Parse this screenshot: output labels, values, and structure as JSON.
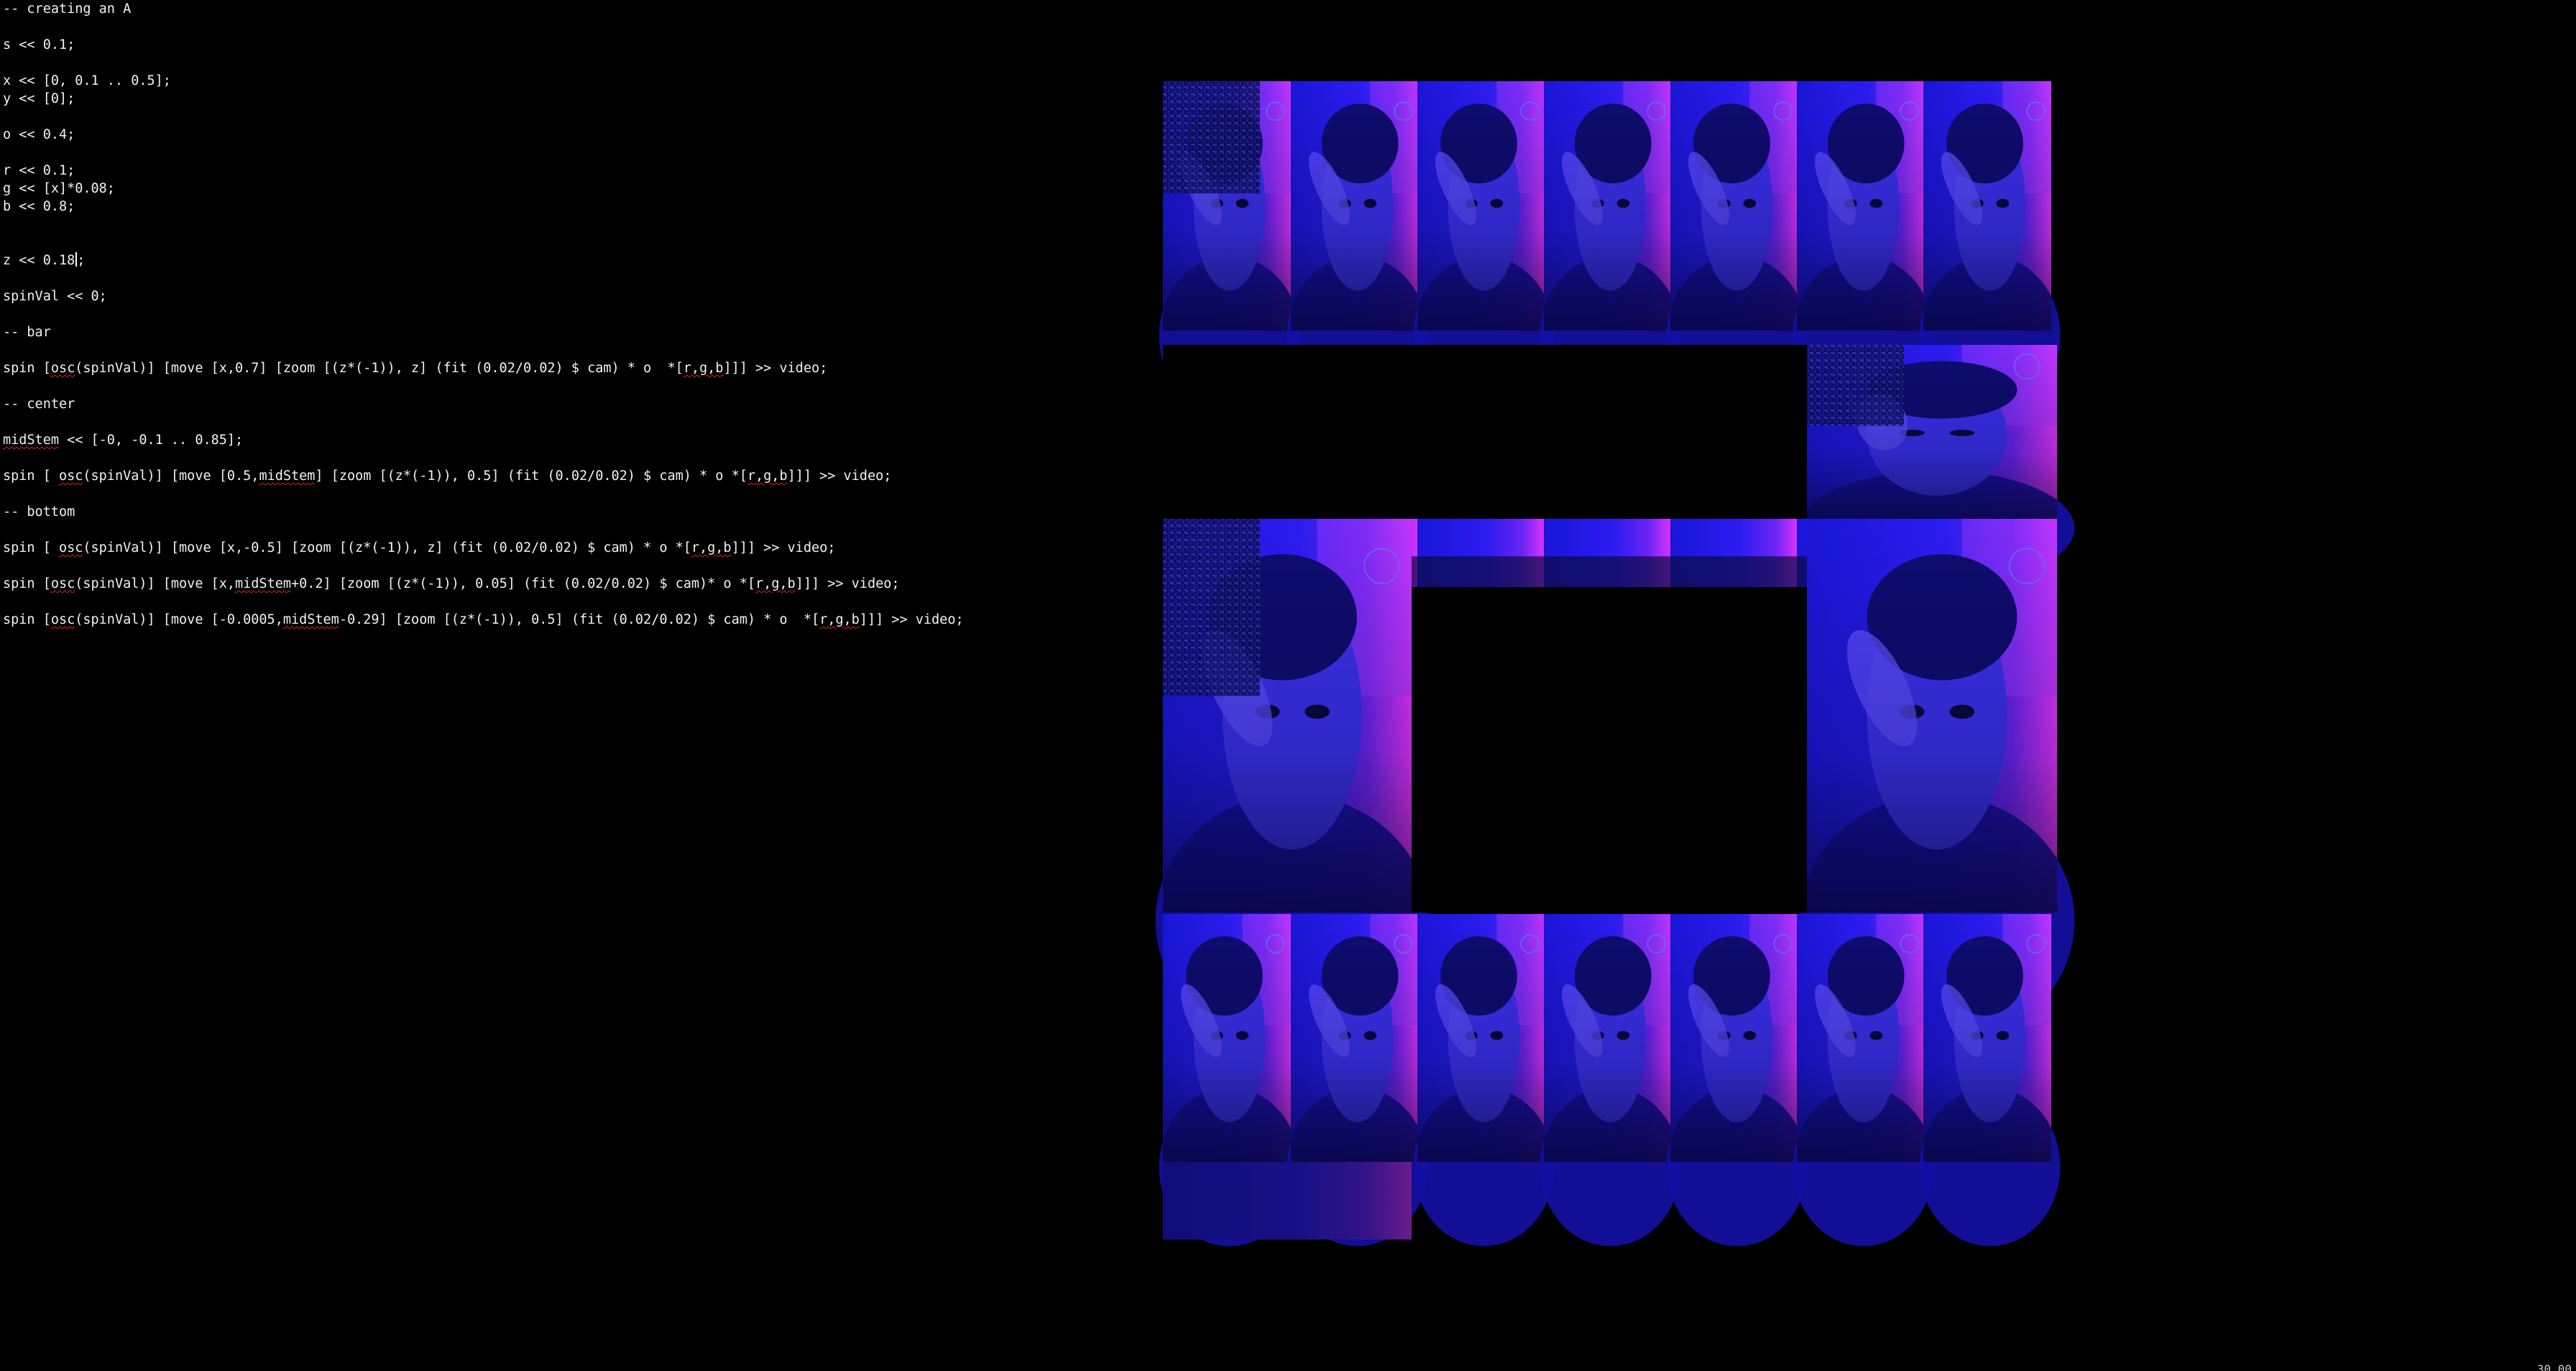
{
  "editor": {
    "lines": [
      "-- creating an A",
      "",
      "s << 0.1;",
      "",
      "x << [0, 0.1 .. 0.5];",
      "y << [0];",
      "",
      "o << 0.4;",
      "",
      "r << 0.1;",
      "g << [x]*0.08;",
      "b << 0.8;",
      "",
      "",
      "z << 0.18;",
      "",
      "spinVal << 0;",
      "",
      "-- bar",
      "",
      "spin [osc(spinVal)] [move [x,0.7] [zoom [(z*(-1)), z] (fit (0.02/0.02) $ cam) * o  *[r,g,b]]] >> video;",
      "",
      "-- center",
      "",
      "midStem << [-0, -0.1 .. 0.85];",
      "",
      "spin [ osc(spinVal)] [move [0.5,midStem] [zoom [(z*(-1)), 0.5] (fit (0.02/0.02) $ cam) * o *[r,g,b]]] >> video;",
      "",
      "-- bottom",
      "",
      "spin [ osc(spinVal)] [move [x,-0.5] [zoom [(z*(-1)), z] (fit (0.02/0.02) $ cam) * o *[r,g,b]]] >> video;",
      "",
      "spin [osc(spinVal)] [move [x,midStem+0.2] [zoom [(z*(-1)), 0.05] (fit (0.02/0.02) $ cam)* o *[r,g,b]]] >> video;",
      "",
      "spin [osc(spinVal)] [move [-0.0005,midStem-0.29] [zoom [(z*(-1)), 0.5] (fit (0.02/0.02) $ cam) * o  *[r,g,b]]] >> video;"
    ],
    "spellcheck_words": [
      "osc",
      "midStem",
      "r,g,b"
    ],
    "cursor_line": 14,
    "cursor_after": "z << 0.18"
  },
  "visual_output": {
    "label": "webcam-video-output",
    "tint_colors": [
      "#1a1ae0",
      "#3b22ff",
      "#8a2be2",
      "#ff33ff",
      "#090935"
    ]
  },
  "status": {
    "corner_readout": "30.00"
  }
}
